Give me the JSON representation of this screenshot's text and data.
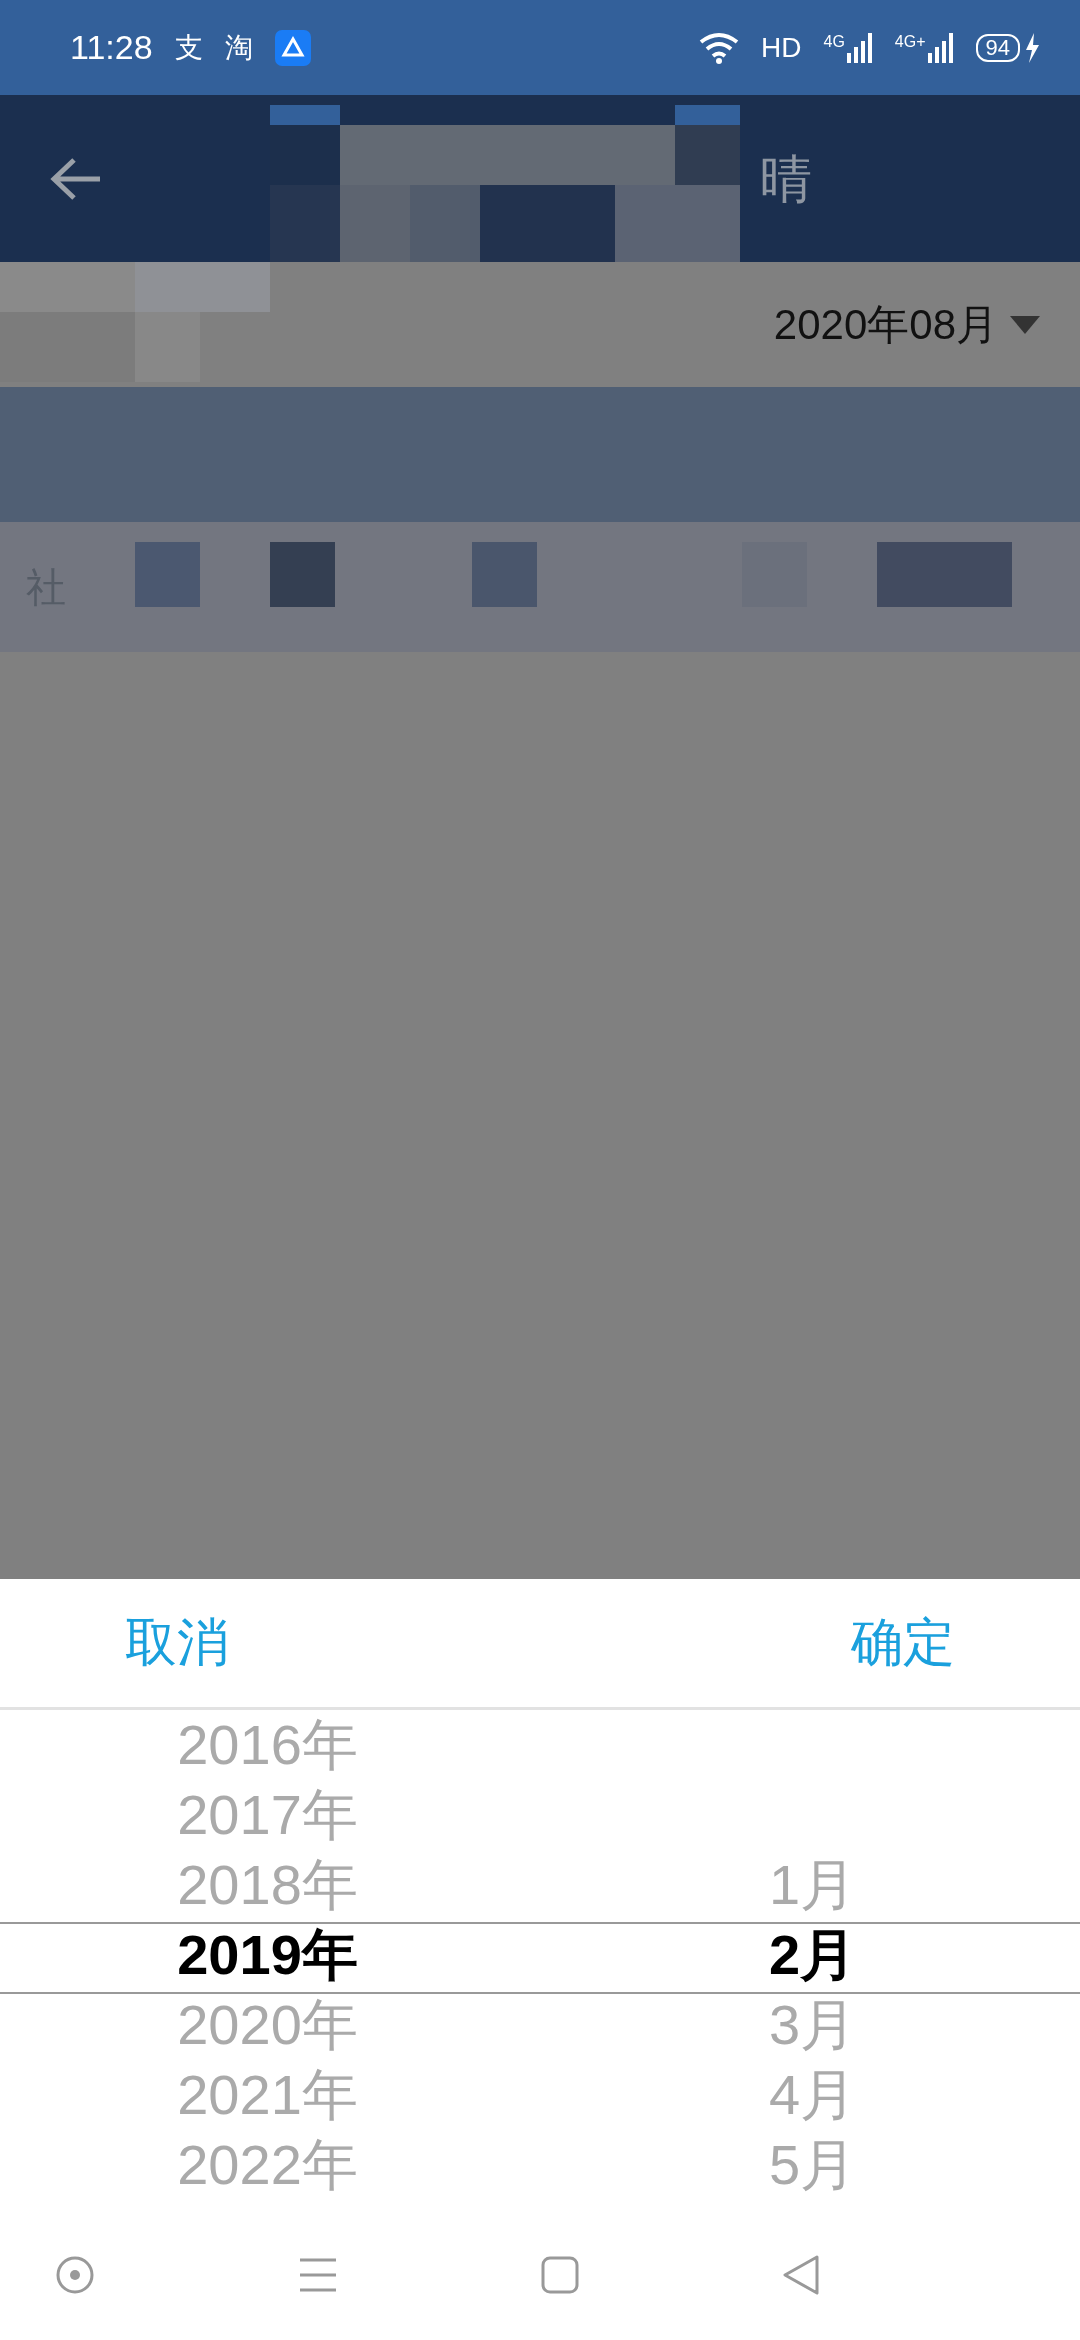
{
  "status_bar": {
    "time": "11:28",
    "notifications": [
      "支",
      "淘"
    ],
    "network_label": "HD",
    "signals": [
      "4G",
      "4G+"
    ],
    "battery": "94"
  },
  "header": {
    "title_fragment": "晴"
  },
  "filter": {
    "month": "2020年08月"
  },
  "list_row": {
    "label_fragment": "社"
  },
  "picker": {
    "cancel": "取消",
    "confirm": "确定",
    "years": [
      {
        "label": "2016年",
        "selected": false
      },
      {
        "label": "2017年",
        "selected": false
      },
      {
        "label": "2018年",
        "selected": false
      },
      {
        "label": "2019年",
        "selected": true
      },
      {
        "label": "2020年",
        "selected": false
      },
      {
        "label": "2021年",
        "selected": false
      },
      {
        "label": "2022年",
        "selected": false
      }
    ],
    "months": [
      {
        "label": "1月",
        "selected": false
      },
      {
        "label": "2月",
        "selected": true
      },
      {
        "label": "3月",
        "selected": false
      },
      {
        "label": "4月",
        "selected": false
      },
      {
        "label": "5月",
        "selected": false
      }
    ]
  }
}
